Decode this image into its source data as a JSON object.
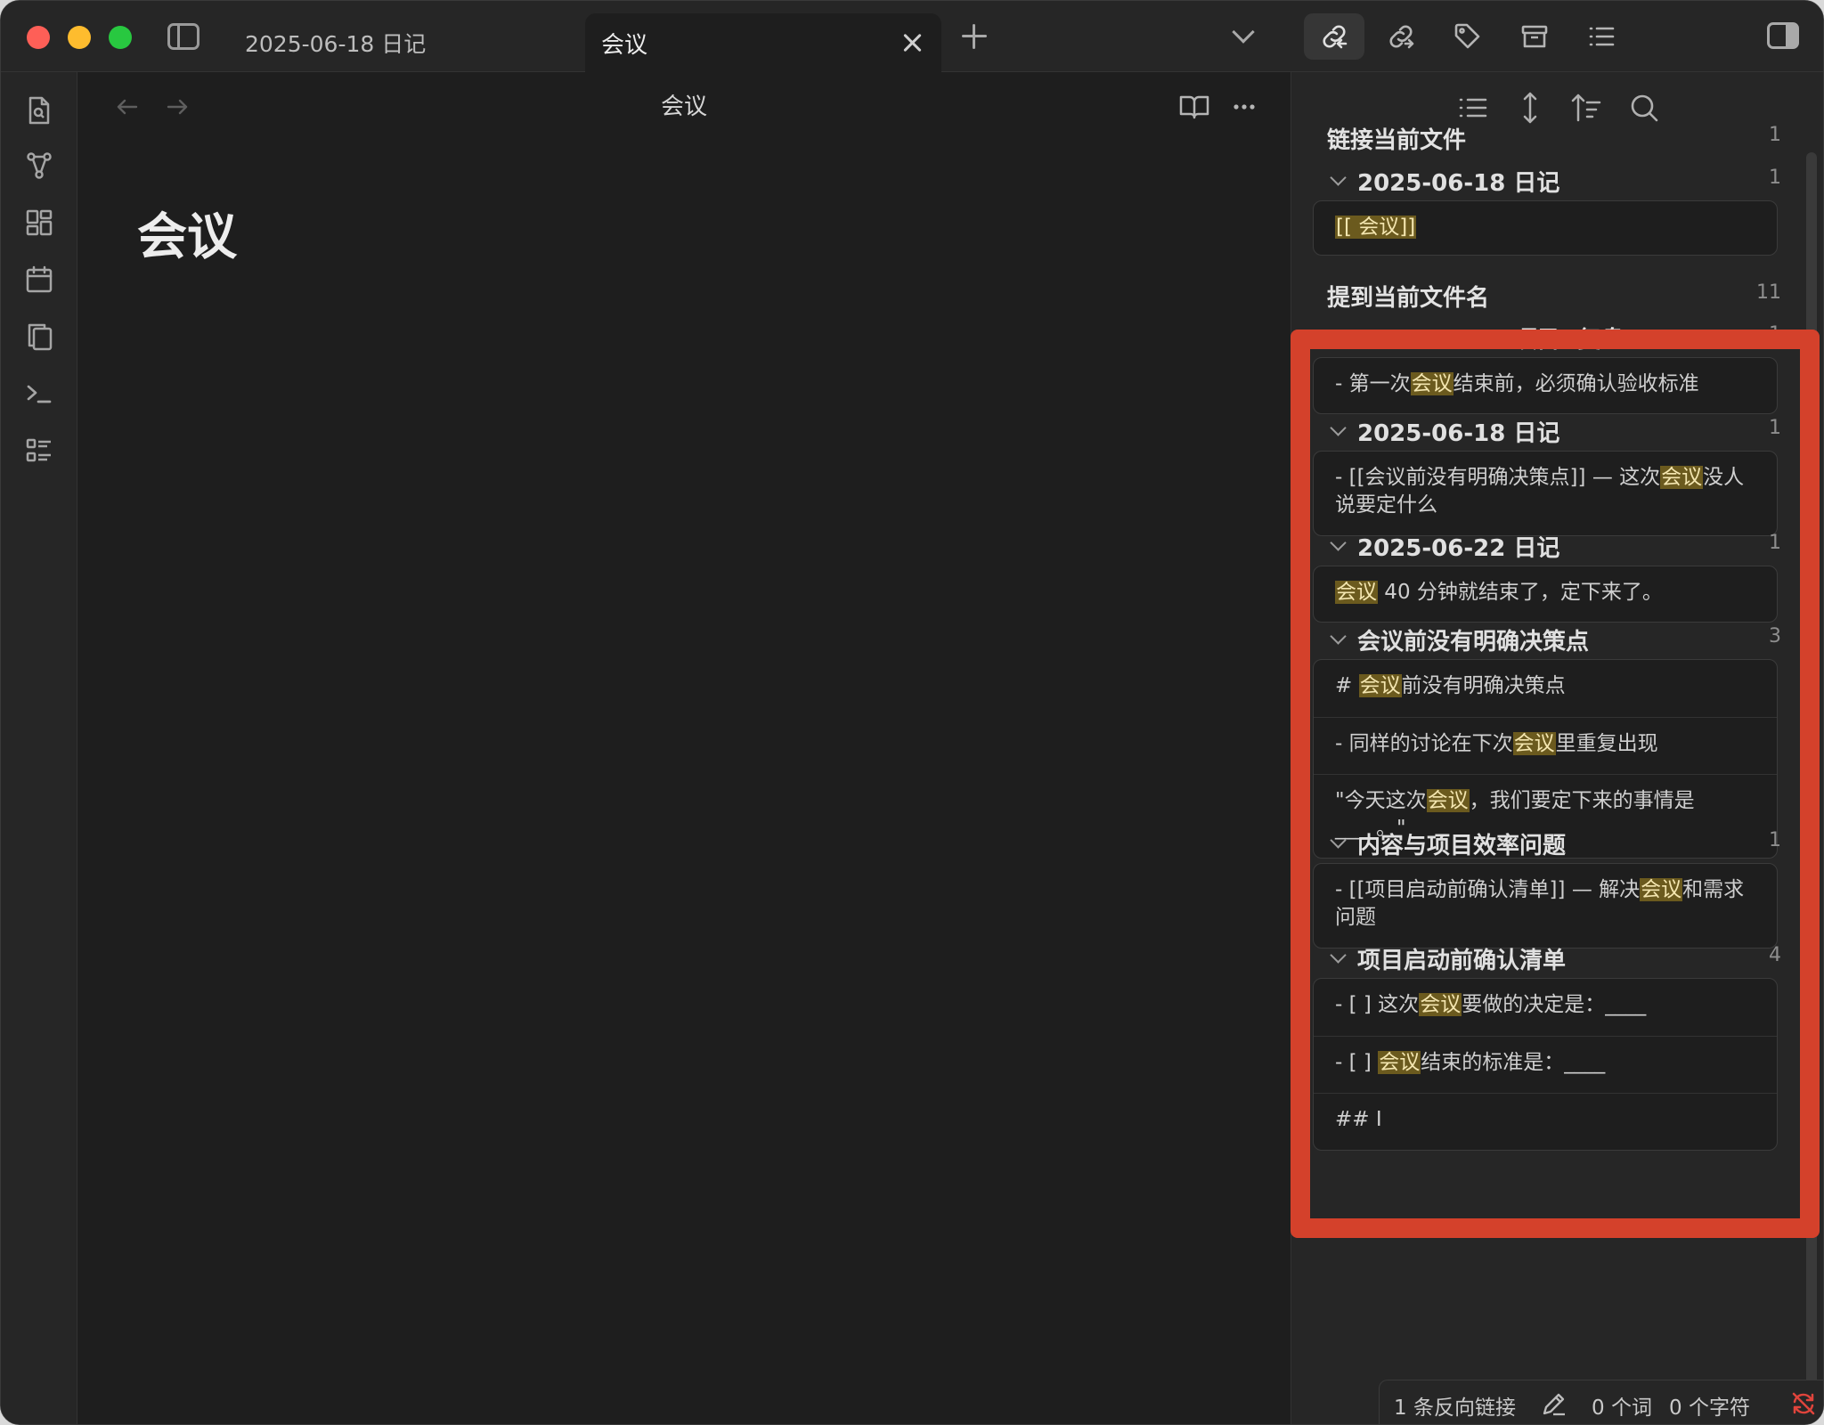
{
  "tabs": [
    {
      "label": "2025-06-18 日记",
      "active": false
    },
    {
      "label": "会议",
      "active": true
    }
  ],
  "editor": {
    "view_title": "会议",
    "note_title": "会议"
  },
  "backlinks": {
    "linked": {
      "title": "链接当前文件",
      "count": "1",
      "files": [
        {
          "name": "2025-06-18 日记",
          "count": "1",
          "lines": [
            [
              {
                "t": "[[ 会议]]",
                "h": true
              }
            ]
          ]
        }
      ]
    },
    "unlinked": {
      "title": "提到当前文件名",
      "count": "11",
      "files": [
        {
          "name": "2025-05-29 项目A复盘",
          "count": "1",
          "lines": [
            [
              {
                "t": "- 第一次"
              },
              {
                "t": "会议",
                "h": true
              },
              {
                "t": "结束前，必须确认验收标准"
              }
            ]
          ]
        },
        {
          "name": "2025-06-18 日记",
          "count": "1",
          "lines": [
            [
              {
                "t": "- [[会议前没有明确决策点]] — 这次"
              },
              {
                "t": "会议",
                "h": true
              },
              {
                "t": "没人说要定什么"
              }
            ]
          ]
        },
        {
          "name": "2025-06-22 日记",
          "count": "1",
          "lines": [
            [
              {
                "t": "会议",
                "h": true
              },
              {
                "t": " 40 分钟就结束了，定下来了。"
              }
            ]
          ]
        },
        {
          "name": "会议前没有明确决策点",
          "count": "3",
          "lines": [
            [
              {
                "t": "# "
              },
              {
                "t": "会议",
                "h": true
              },
              {
                "t": "前没有明确决策点"
              }
            ],
            [
              {
                "t": "- 同样的讨论在下次"
              },
              {
                "t": "会议",
                "h": true
              },
              {
                "t": "里重复出现"
              }
            ],
            [
              {
                "t": "\"今天这次"
              },
              {
                "t": "会议",
                "h": true
              },
              {
                "t": "，我们要定下来的事情是 ____。\""
              }
            ]
          ]
        },
        {
          "name": "内容与项目效率问题",
          "count": "1",
          "lines": [
            [
              {
                "t": "- [[项目启动前确认清单]] — 解决"
              },
              {
                "t": "会议",
                "h": true
              },
              {
                "t": "和需求问题"
              }
            ]
          ]
        },
        {
          "name": "项目启动前确认清单",
          "count": "4",
          "lines": [
            [
              {
                "t": "- [ ] 这次"
              },
              {
                "t": "会议",
                "h": true
              },
              {
                "t": "要做的决定是：____"
              }
            ],
            [
              {
                "t": "- [ ] "
              },
              {
                "t": "会议",
                "h": true
              },
              {
                "t": "结束的标准是：____"
              }
            ],
            [
              {
                "t": "## I"
              }
            ]
          ]
        }
      ]
    }
  },
  "statusbar": {
    "backlinks": "1 条反向链接",
    "words": "0 个词",
    "chars": "0 个字符"
  },
  "icons": {
    "ribbon": [
      "file-search-icon",
      "graph-icon",
      "canvas-icon",
      "calendar-icon",
      "copy-icon",
      "terminal-icon",
      "outline-list-icon"
    ],
    "toolbar": [
      "backlinks-icon",
      "outgoing-links-icon",
      "tag-icon",
      "archive-icon",
      "outline-icon"
    ]
  },
  "colors": {
    "highlight_box": "#d4412b",
    "search_highlight": "#6b5a1e"
  }
}
